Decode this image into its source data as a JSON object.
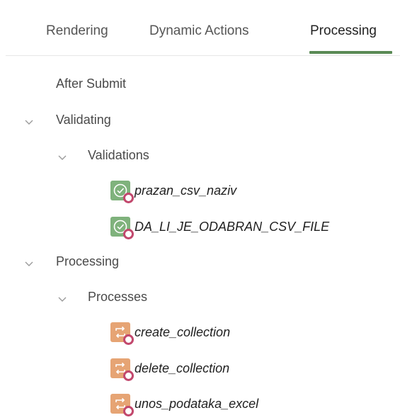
{
  "tabs": [
    {
      "label": "Rendering",
      "active": false
    },
    {
      "label": "Dynamic Actions",
      "active": false
    },
    {
      "label": "Processing",
      "active": true
    }
  ],
  "tree": {
    "after_submit": "After Submit",
    "validating": {
      "label": "Validating",
      "group": "Validations",
      "items": [
        {
          "label": "prazan_csv_naziv",
          "icon": "validation-icon"
        },
        {
          "label": "DA_LI_JE_ODABRAN_CSV_FILE",
          "icon": "validation-icon"
        }
      ]
    },
    "processing": {
      "label": "Processing",
      "group": "Processes",
      "items": [
        {
          "label": "create_collection",
          "icon": "process-icon"
        },
        {
          "label": "delete_collection",
          "icon": "process-icon"
        },
        {
          "label": "unos_podataka_excel",
          "icon": "process-icon"
        }
      ]
    }
  },
  "colors": {
    "accent_underline": "#5a8a55",
    "validation_icon": "#7fb27c",
    "process_icon": "#e6a474",
    "badge": "#c2486d"
  }
}
